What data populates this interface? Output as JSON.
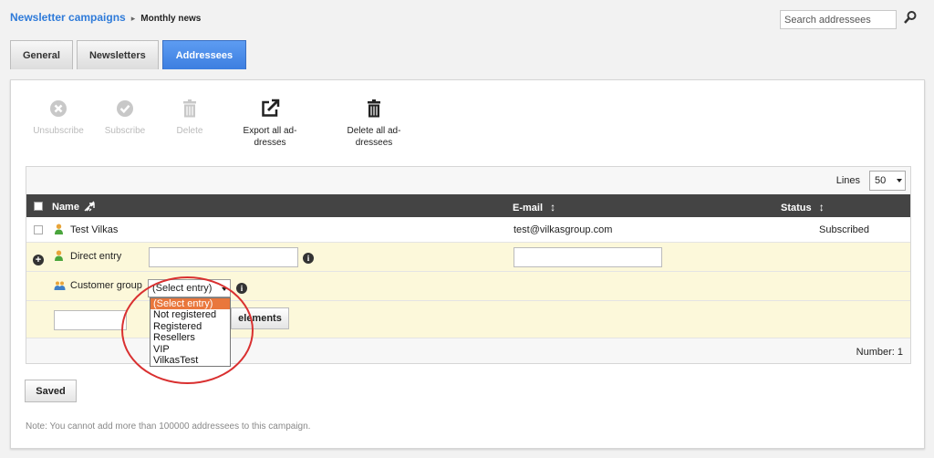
{
  "breadcrumb": {
    "parent": "Newsletter campaigns",
    "separator": "▸",
    "current": "Monthly news"
  },
  "search": {
    "placeholder": "Search addressees"
  },
  "tabs": [
    {
      "label": "General",
      "active": false
    },
    {
      "label": "Newsletters",
      "active": false
    },
    {
      "label": "Addressees",
      "active": true
    }
  ],
  "toolbar": {
    "unsubscribe": {
      "label": "Unsubscribe",
      "icon": "unsubscribe-icon",
      "enabled": false
    },
    "subscribe": {
      "label": "Subscribe",
      "icon": "subscribe-icon",
      "enabled": false
    },
    "delete": {
      "label": "Delete",
      "icon": "trash-icon",
      "enabled": false
    },
    "export_all": {
      "label_line1": "Export all ad-",
      "label_line2": "dresses",
      "icon": "export-icon",
      "enabled": true
    },
    "delete_all": {
      "label_line1": "Delete all ad-",
      "label_line2": "dressees",
      "icon": "trash-icon",
      "enabled": true
    }
  },
  "grid": {
    "lines_label": "Lines",
    "lines_value": "50",
    "columns": {
      "name": "Name",
      "email": "E-mail",
      "status": "Status"
    },
    "rows": [
      {
        "name": "Test Vilkas",
        "email": "test@vilkasgroup.com",
        "status": "Subscribed"
      }
    ],
    "direct_entry_label": "Direct entry",
    "customer_group_label": "Customer group",
    "customer_group_selected": "(Select entry)",
    "add_elements_label": "elements",
    "number_text": "Number: 1"
  },
  "dropdown": {
    "options": [
      "(Select entry)",
      "Not registered",
      "Registered",
      "Resellers",
      "VIP",
      "VilkasTest"
    ],
    "selected_index": 0
  },
  "saved_label": "Saved",
  "note": "Note: You cannot add more than 100000 addressees to this campaign.",
  "colors": {
    "accent": "#3c7ee0",
    "link": "#2f7bd9",
    "highlight": "#e9773c",
    "annotation": "#d93030",
    "row_yellow": "#fcf8da"
  }
}
